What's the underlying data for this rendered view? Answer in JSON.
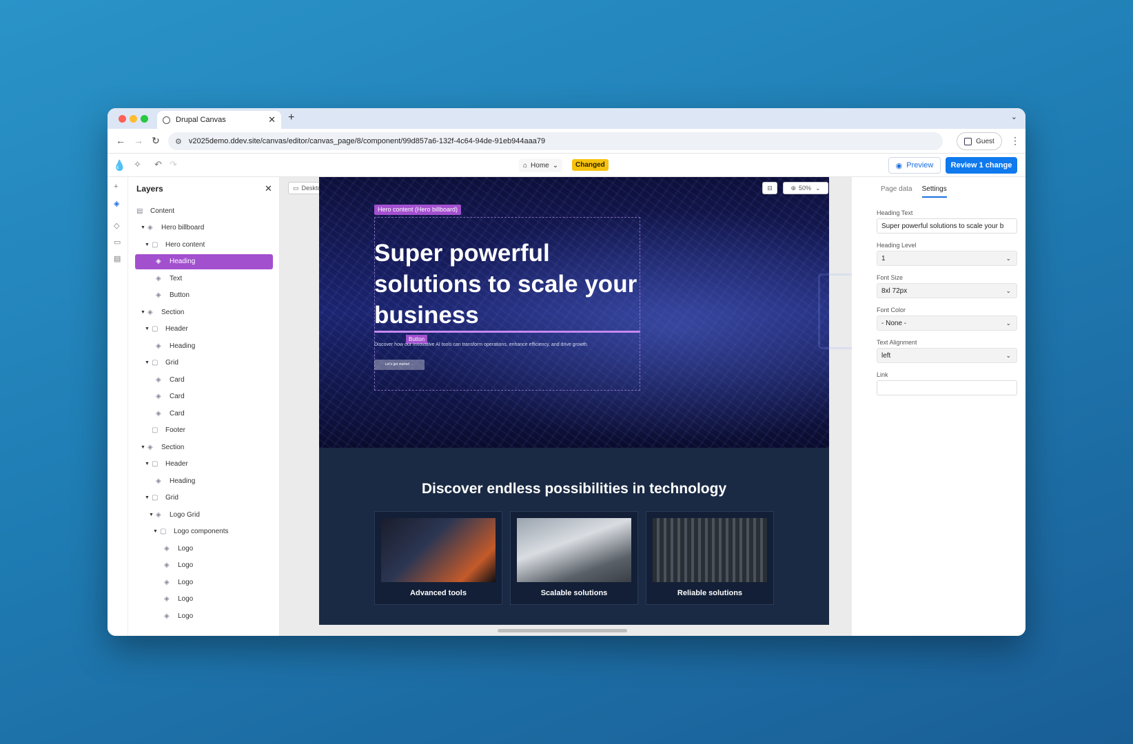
{
  "browser": {
    "tab_title": "Drupal Canvas",
    "tab_close": "✕",
    "new_tab": "+",
    "url": "v2025demo.ddev.site/canvas/editor/canvas_page/8/component/99d857a6-132f-4c64-94de-91eb944aaa79",
    "profile_label": "Guest"
  },
  "toolbar": {
    "page_label": "Home",
    "status_badge": "Changed",
    "preview_label": "Preview",
    "review_label": "Review 1 change"
  },
  "layers": {
    "title": "Layers",
    "items": [
      {
        "label": "Content",
        "depth": 0,
        "caret": false,
        "icon": "page-icon"
      },
      {
        "label": "Hero billboard",
        "depth": 1,
        "caret": true,
        "icon": "component-icon"
      },
      {
        "label": "Hero content",
        "depth": 2,
        "caret": true,
        "icon": "slot-icon"
      },
      {
        "label": "Heading",
        "depth": 3,
        "caret": false,
        "icon": "component-icon",
        "selected": true
      },
      {
        "label": "Text",
        "depth": 3,
        "caret": false,
        "icon": "component-icon"
      },
      {
        "label": "Button",
        "depth": 3,
        "caret": false,
        "icon": "component-icon"
      },
      {
        "label": "Section",
        "depth": 1,
        "caret": true,
        "icon": "component-icon"
      },
      {
        "label": "Header",
        "depth": 2,
        "caret": true,
        "icon": "slot-icon"
      },
      {
        "label": "Heading",
        "depth": 3,
        "caret": false,
        "icon": "component-icon"
      },
      {
        "label": "Grid",
        "depth": 2,
        "caret": true,
        "icon": "slot-icon"
      },
      {
        "label": "Card",
        "depth": 3,
        "caret": false,
        "icon": "component-icon"
      },
      {
        "label": "Card",
        "depth": 3,
        "caret": false,
        "icon": "component-icon"
      },
      {
        "label": "Card",
        "depth": 3,
        "caret": false,
        "icon": "component-icon"
      },
      {
        "label": "Footer",
        "depth": 2,
        "caret": false,
        "icon": "slot-icon"
      },
      {
        "label": "Section",
        "depth": 1,
        "caret": true,
        "icon": "component-icon"
      },
      {
        "label": "Header",
        "depth": 2,
        "caret": true,
        "icon": "slot-icon"
      },
      {
        "label": "Heading",
        "depth": 3,
        "caret": false,
        "icon": "component-icon"
      },
      {
        "label": "Grid",
        "depth": 2,
        "caret": true,
        "icon": "slot-icon"
      },
      {
        "label": "Logo Grid",
        "depth": 3,
        "caret": true,
        "icon": "component-icon"
      },
      {
        "label": "Logo components",
        "depth": 4,
        "caret": true,
        "icon": "slot-icon"
      },
      {
        "label": "Logo",
        "depth": 5,
        "caret": false,
        "icon": "component-icon"
      },
      {
        "label": "Logo",
        "depth": 5,
        "caret": false,
        "icon": "component-icon"
      },
      {
        "label": "Logo",
        "depth": 5,
        "caret": false,
        "icon": "component-icon"
      },
      {
        "label": "Logo",
        "depth": 5,
        "caret": false,
        "icon": "component-icon"
      },
      {
        "label": "Logo",
        "depth": 5,
        "caret": false,
        "icon": "component-icon"
      }
    ]
  },
  "canvas": {
    "viewport_label": "Desktop",
    "zoom_label": "50%",
    "hero_tag": "Hero content (Hero billboard)",
    "hero_heading": "Super powerful solutions to scale your business",
    "button_tag": "Button",
    "hero_text": "Discover how our innovative AI tools can transform operations, enhance efficiency, and drive growth.",
    "hero_button": "Let's get started →",
    "section_title": "Discover endless possibilities in technology",
    "cards": [
      {
        "label": "Advanced tools"
      },
      {
        "label": "Scalable solutions"
      },
      {
        "label": "Reliable solutions"
      }
    ]
  },
  "settings": {
    "tabs": [
      "Page data",
      "Settings"
    ],
    "active_tab": "Settings",
    "heading_text_label": "Heading Text",
    "heading_text_value": "Super powerful solutions to scale your b",
    "heading_level_label": "Heading Level",
    "heading_level_value": "1",
    "font_size_label": "Font Size",
    "font_size_value": "8xl 72px",
    "font_color_label": "Font Color",
    "font_color_value": "- None -",
    "text_alignment_label": "Text Alignment",
    "text_alignment_value": "left",
    "link_label": "Link",
    "link_value": ""
  },
  "colors": {
    "accent": "#a350cf",
    "primary_button": "#0f79ee",
    "changed_badge": "#f6c20f"
  }
}
